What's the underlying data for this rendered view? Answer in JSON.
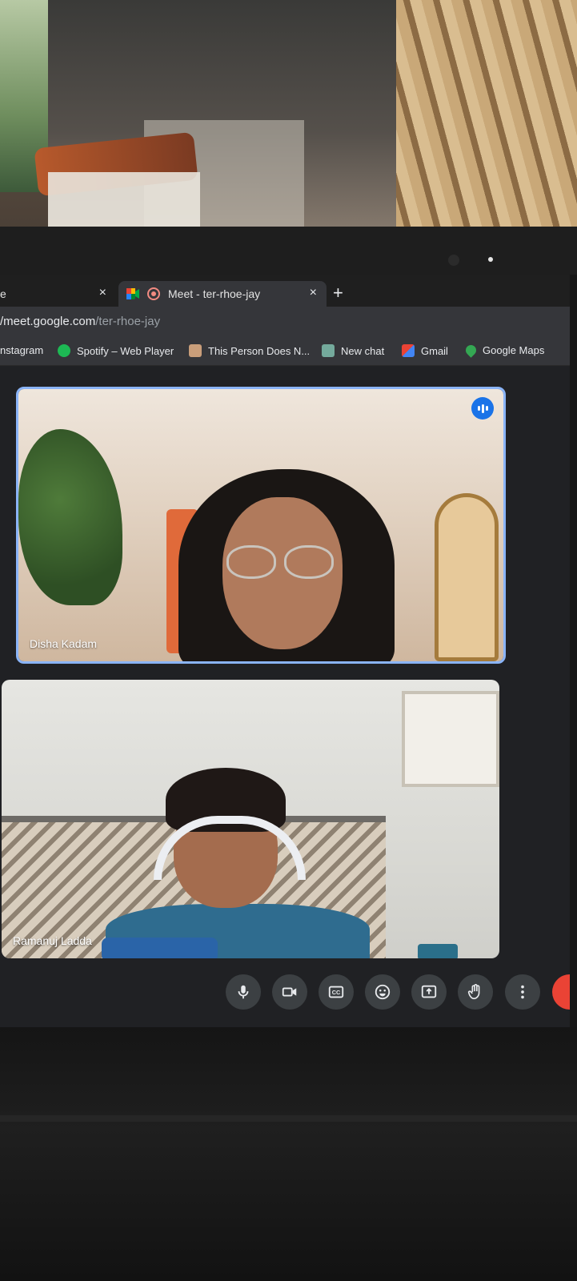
{
  "browser": {
    "tabs": [
      {
        "label": "e",
        "active": false
      },
      {
        "label": "Meet - ter-rhoe-jay",
        "active": true
      }
    ],
    "close_glyph": "×",
    "new_tab_glyph": "+",
    "url_host": "/meet.google.com",
    "url_path": "/ter-rhoe-jay",
    "bookmarks": [
      {
        "label": "nstagram",
        "icon": "instagram-icon"
      },
      {
        "label": "Spotify – Web Player",
        "icon": "spotify-icon",
        "color": "#1db954"
      },
      {
        "label": "This Person Does N...",
        "icon": "face-icon"
      },
      {
        "label": "New chat",
        "icon": "chatgpt-icon",
        "color": "#74aa9c"
      },
      {
        "label": "Gmail",
        "icon": "gmail-icon",
        "color": "#ea4335"
      },
      {
        "label": "Google Maps",
        "icon": "maps-icon",
        "color": "#34a853"
      }
    ]
  },
  "meet": {
    "participants": [
      {
        "name": "Disha Kadam",
        "speaking": true
      },
      {
        "name": "Ramanuj Ladda",
        "speaking": false
      }
    ],
    "controls": [
      {
        "name": "microphone-icon"
      },
      {
        "name": "camera-icon"
      },
      {
        "name": "captions-icon"
      },
      {
        "name": "emoji-icon"
      },
      {
        "name": "present-icon"
      },
      {
        "name": "raise-hand-icon"
      },
      {
        "name": "more-options-icon"
      },
      {
        "name": "leave-call-icon"
      }
    ],
    "captions_label": "CC"
  },
  "colors": {
    "accent": "#8ab4f8",
    "speaking": "#1a73e8",
    "leave": "#ea4335"
  }
}
